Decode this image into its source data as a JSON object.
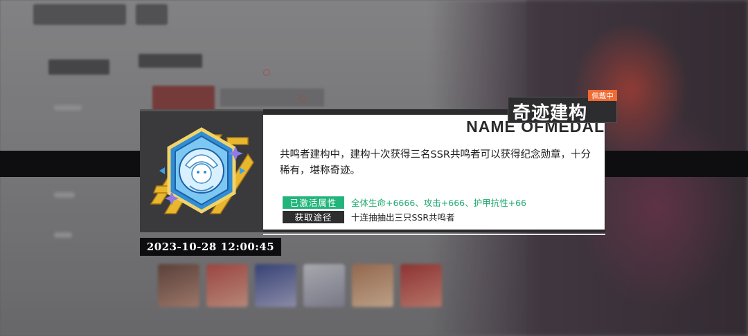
{
  "medal": {
    "name_en": "NAME OFMEDAL",
    "title": "奇迹建构",
    "status_badge": "佩戴中",
    "description": "共鸣者建构中，建构十次获得三名SSR共鸣者可以获得纪念勋章，十分稀有，堪称奇迹。",
    "activated_label": "已激活属性",
    "activated_value": "全体生命+6666、攻击+666、护甲抗性+66",
    "source_label": "获取途径",
    "source_value": "十连抽抽出三只SSR共鸣者",
    "obtained_at": "2023-10-28 12:00:45",
    "icon": "medal-badge-icon"
  },
  "colors": {
    "accent_green": "#22b47a",
    "badge_orange": "#f06a32",
    "panel_dark": "#2b2b2d"
  }
}
